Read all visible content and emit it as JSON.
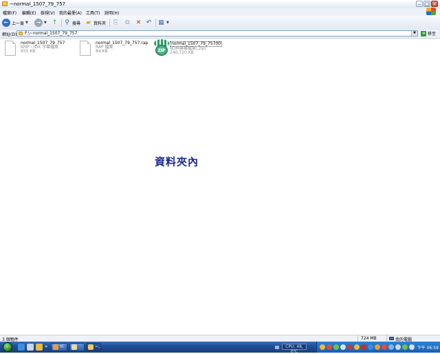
{
  "window": {
    "title": "~normal_1507_79_757"
  },
  "menubar": {
    "items": [
      "檔案(F)",
      "編輯(E)",
      "檢視(V)",
      "我的最愛(A)",
      "工具(T)",
      "說明(H)"
    ]
  },
  "toolbar": {
    "back_label": "上一頁",
    "search_label": "搜尋",
    "folders_label": "資料夾"
  },
  "address": {
    "label": "網址(D)",
    "value": "F:\\~normal_1507_79_757",
    "go_label": "移至"
  },
  "files": [
    {
      "name": "normal_1507_79_757",
      "type": "KMP - IDX 字幕檔案",
      "size": "655 KB"
    },
    {
      "name": "normal_1507_79_757.rap",
      "type": "RAP 檔案",
      "size": "84 KB"
    },
    {
      "name": "normal_1507_79_75700",
      "type": "BOM專屬檔案(.zip)",
      "size": "240,720 KB"
    }
  ],
  "watermark": "資料夾內",
  "statusbar": {
    "objects": "3 個物件",
    "size": "724 MB",
    "location": "我的電腦"
  },
  "taskbar": {
    "cpu": "CPU: 48, 0℃",
    "clock": "下午 06:59",
    "tasks": [
      "Yi",
      "",
      "~..."
    ]
  }
}
